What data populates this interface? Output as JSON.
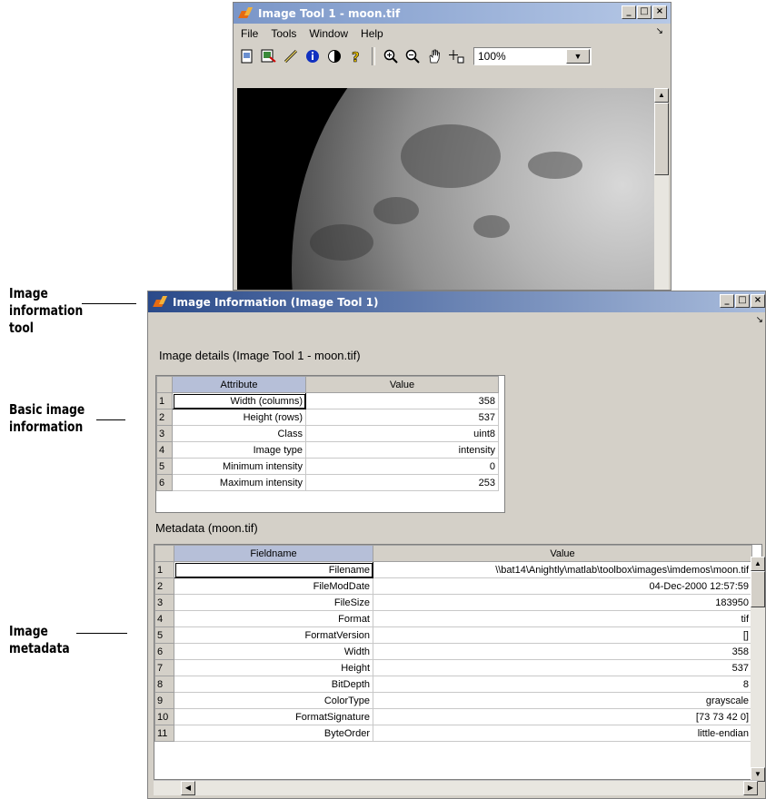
{
  "image_tool": {
    "title": "Image Tool 1 - moon.tif",
    "menu": [
      "File",
      "Tools",
      "Window",
      "Help"
    ],
    "zoom": "100%",
    "toolbar_icons": [
      "new-figure-icon",
      "export-icon",
      "measure-icon",
      "info-icon",
      "contrast-icon",
      "help-icon",
      "zoom-in-icon",
      "zoom-out-icon",
      "pan-icon",
      "pixel-region-icon"
    ]
  },
  "info_window": {
    "title": "Image Information (Image Tool 1)",
    "details_label": "Image details  (Image Tool 1 - moon.tif)",
    "details_table": {
      "headers": [
        "Attribute",
        "Value"
      ],
      "rows": [
        {
          "n": "1",
          "attr": "Width (columns)",
          "value": "358"
        },
        {
          "n": "2",
          "attr": "Height (rows)",
          "value": "537"
        },
        {
          "n": "3",
          "attr": "Class",
          "value": "uint8"
        },
        {
          "n": "4",
          "attr": "Image type",
          "value": "intensity"
        },
        {
          "n": "5",
          "attr": "Minimum intensity",
          "value": "0"
        },
        {
          "n": "6",
          "attr": "Maximum intensity",
          "value": "253"
        }
      ]
    },
    "metadata_label": "Metadata (moon.tif)",
    "metadata_table": {
      "headers": [
        "Fieldname",
        "Value"
      ],
      "rows": [
        {
          "n": "1",
          "field": "Filename",
          "value": "\\\\bat14\\Anightly\\matlab\\toolbox\\images\\imdemos\\moon.tif"
        },
        {
          "n": "2",
          "field": "FileModDate",
          "value": "04-Dec-2000 12:57:59"
        },
        {
          "n": "3",
          "field": "FileSize",
          "value": "183950"
        },
        {
          "n": "4",
          "field": "Format",
          "value": "tif"
        },
        {
          "n": "5",
          "field": "FormatVersion",
          "value": "[]"
        },
        {
          "n": "6",
          "field": "Width",
          "value": "358"
        },
        {
          "n": "7",
          "field": "Height",
          "value": "537"
        },
        {
          "n": "8",
          "field": "BitDepth",
          "value": "8"
        },
        {
          "n": "9",
          "field": "ColorType",
          "value": "grayscale"
        },
        {
          "n": "10",
          "field": "FormatSignature",
          "value": "[73 73 42 0]"
        },
        {
          "n": "11",
          "field": "ByteOrder",
          "value": "little-endian"
        }
      ]
    }
  },
  "callouts": {
    "info_tool": [
      "Image",
      "information",
      "tool"
    ],
    "basic_info": [
      "Basic image",
      "information"
    ],
    "metadata": [
      "Image",
      "metadata"
    ]
  }
}
